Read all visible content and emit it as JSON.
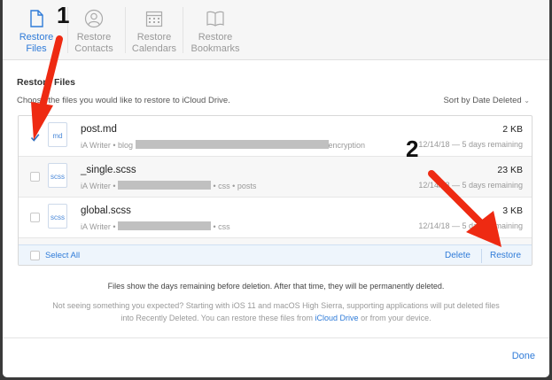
{
  "tabs": [
    {
      "line1": "Restore",
      "line2": "Files",
      "icon": "file-icon",
      "active": true
    },
    {
      "line1": "Restore",
      "line2": "Contacts",
      "icon": "contact-icon",
      "active": false
    },
    {
      "line1": "Restore",
      "line2": "Calendars",
      "icon": "calendar-icon",
      "active": false
    },
    {
      "line1": "Restore",
      "line2": "Bookmarks",
      "icon": "book-icon",
      "active": false
    }
  ],
  "section": {
    "title": "Restore Files",
    "subtitle": "Choose the files you would like to restore to iCloud Drive.",
    "sort_label": "Sort by Date Deleted"
  },
  "files": [
    {
      "name": "post.md",
      "ext": "md",
      "path_prefix": "iA Writer • blog",
      "path_suffix": "encryption",
      "size": "2 KB",
      "date": "12/14/18 — 5 days remaining",
      "checked": true
    },
    {
      "name": "_single.scss",
      "ext": "scss",
      "path_prefix": "iA Writer •",
      "path_suffix": "• css • posts",
      "size": "23 KB",
      "date": "12/14/18 — 5 days remaining",
      "checked": false
    },
    {
      "name": "global.scss",
      "ext": "scss",
      "path_prefix": "iA Writer •",
      "path_suffix": "• css",
      "size": "3 KB",
      "date": "12/14/18 — 5 days remaining",
      "checked": false
    }
  ],
  "footer": {
    "select_all": "Select All",
    "delete": "Delete",
    "restore": "Restore"
  },
  "notes": {
    "line1": "Files show the days remaining before deletion. After that time, they will be permanently deleted.",
    "line2_a": "Not seeing something you expected? Starting with iOS 11 and macOS High Sierra, supporting applications will put deleted files into Recently Deleted. You can restore these files from ",
    "line2_link": "iCloud Drive",
    "line2_b": " or from your device."
  },
  "done_label": "Done",
  "annotations": {
    "one": "1",
    "two": "2"
  },
  "colors": {
    "accent": "#2f7bd8",
    "annotation_arrow": "#ee2a12"
  }
}
